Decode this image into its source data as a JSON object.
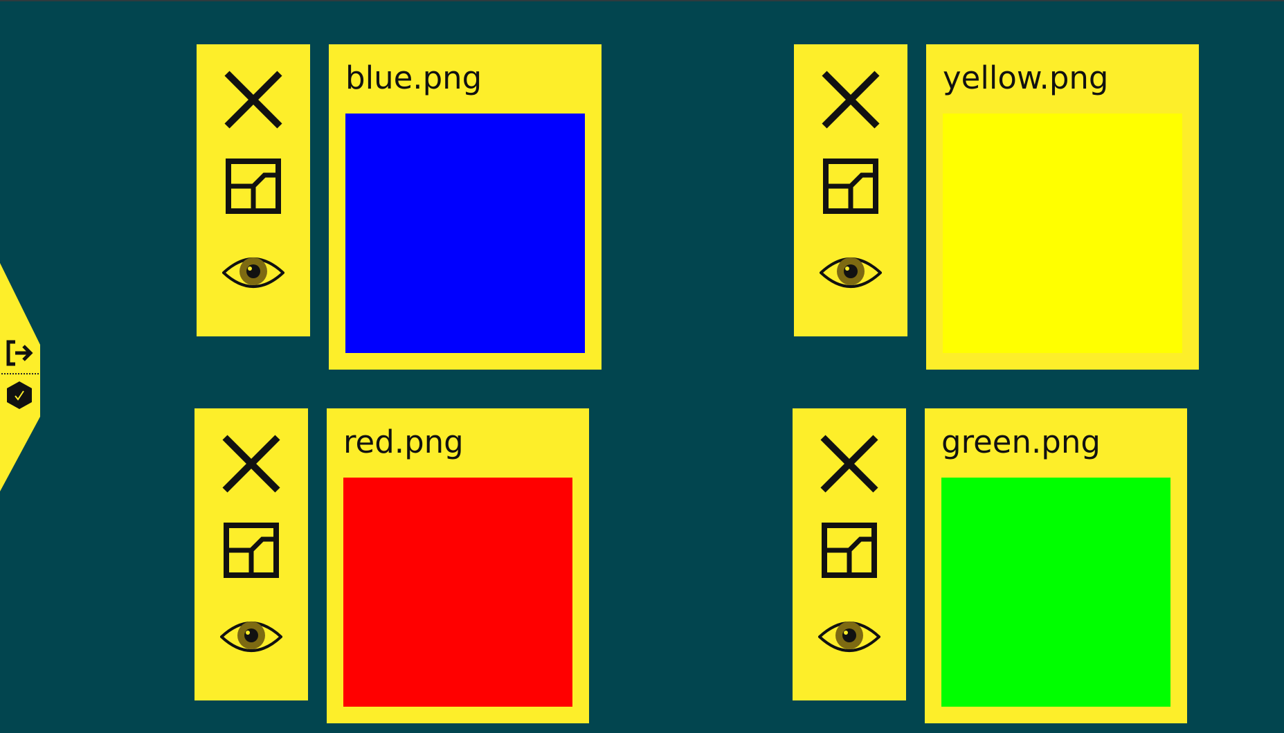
{
  "dock": {
    "items": [
      {
        "id": "exit",
        "icon": "logout-icon"
      },
      {
        "id": "settings",
        "icon": "hexagon-settings-icon"
      }
    ]
  },
  "cards": [
    {
      "title": "blue.png",
      "color": "#0000ff"
    },
    {
      "title": "yellow.png",
      "color": "#ffff00"
    },
    {
      "title": "red.png",
      "color": "#ff0000"
    },
    {
      "title": "green.png",
      "color": "#00ff00"
    }
  ],
  "toolbar": {
    "icons": [
      "close-icon",
      "window-restore-icon",
      "eye-icon"
    ]
  },
  "colors": {
    "background": "#02454f",
    "panel": "#fdee2a"
  }
}
